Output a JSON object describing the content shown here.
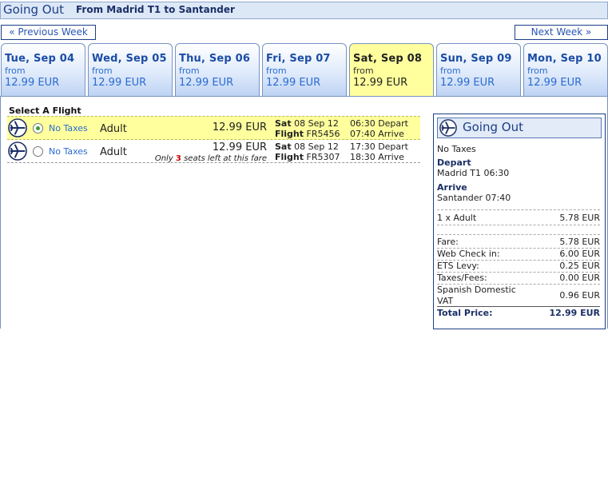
{
  "header": {
    "title": "Going Out",
    "route": "From Madrid T1 to Santander"
  },
  "nav": {
    "prev": "« Previous Week",
    "next": "Next Week »"
  },
  "days": [
    {
      "name": "Tue, Sep 04",
      "from": "from",
      "price": "12.99 EUR"
    },
    {
      "name": "Wed, Sep 05",
      "from": "from",
      "price": "12.99 EUR"
    },
    {
      "name": "Thu, Sep 06",
      "from": "from",
      "price": "12.99 EUR"
    },
    {
      "name": "Fri, Sep 07",
      "from": "from",
      "price": "12.99 EUR"
    },
    {
      "name": "Sat, Sep 08",
      "from": "from",
      "price": "12.99 EUR",
      "selected": true
    },
    {
      "name": "Sun, Sep 09",
      "from": "from",
      "price": "12.99 EUR"
    },
    {
      "name": "Mon, Sep 10",
      "from": "from",
      "price": "12.99 EUR"
    }
  ],
  "select_label": "Select A Flight",
  "flights": [
    {
      "tax": "No Taxes",
      "pax": "Adult",
      "price": "12.99 EUR",
      "day": "Sat",
      "date": "08 Sep 12",
      "flight_label": "Flight",
      "flight_no": "FR5456",
      "depart": "06:30 Depart",
      "arrive": "07:40 Arrive",
      "selected": true
    },
    {
      "tax": "No Taxes",
      "pax": "Adult",
      "price": "12.99 EUR",
      "seats_pre": "Only",
      "seats_count": "3",
      "seats_post": "seats left at this fare",
      "day": "Sat",
      "date": "08 Sep 12",
      "flight_label": "Flight",
      "flight_no": "FR5307",
      "depart": "17:30 Depart",
      "arrive": "18:30 Arrive",
      "selected": false
    }
  ],
  "summary": {
    "title": "Going Out",
    "tax": "No Taxes",
    "depart_label": "Depart",
    "depart_value": "Madrid T1 06:30",
    "arrive_label": "Arrive",
    "arrive_value": "Santander 07:40",
    "pax_label": "1 x Adult",
    "pax_value": "5.78 EUR",
    "fare_label": "Fare:",
    "fare_value": "5.78 EUR",
    "checkin_label": "Web Check in:",
    "checkin_value": "6.00 EUR",
    "ets_label": "ETS Levy:",
    "ets_value": "0.25 EUR",
    "taxes_label": "Taxes/Fees:",
    "taxes_value": "0.00 EUR",
    "vat_label_1": "Spanish Domestic",
    "vat_label_2": "VAT",
    "vat_value": "0.96 EUR",
    "total_label": "Total Price:",
    "total_value": "12.99 EUR"
  },
  "colors": {
    "accent": "#1b3e86",
    "highlight": "#ffff9d",
    "link": "#2a6bd2"
  },
  "icons": {
    "plane": "airplane-icon"
  }
}
